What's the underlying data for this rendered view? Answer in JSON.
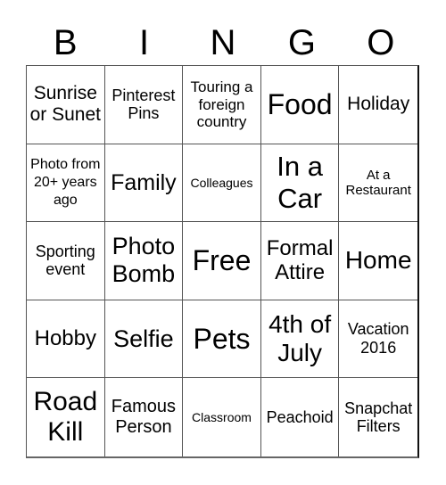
{
  "header": {
    "letters": [
      "B",
      "I",
      "N",
      "G",
      "O"
    ]
  },
  "cells": [
    [
      "Sunrise or Sunet",
      "Pinterest Pins",
      "Touring a foreign country",
      "Food",
      "Holiday"
    ],
    [
      "Photo from 20+ years ago",
      "Family",
      "Colleagues",
      "In a Car",
      "At a Restaurant"
    ],
    [
      "Sporting event",
      "Photo Bomb",
      "Free",
      "Formal Attire",
      "Home"
    ],
    [
      "Hobby",
      "Selfie",
      "Pets",
      "4th of July",
      "Vacation 2016"
    ],
    [
      "Road Kill",
      "Famous Person",
      "Classroom",
      "Peachoid",
      "Snapchat Filters"
    ]
  ]
}
